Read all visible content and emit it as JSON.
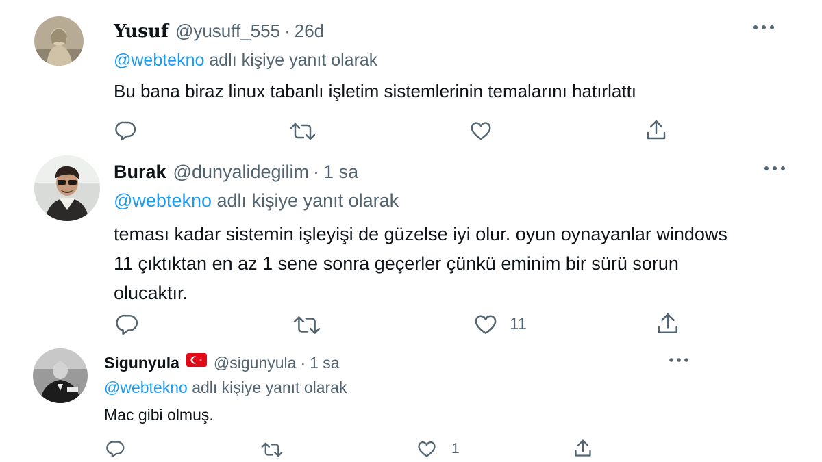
{
  "tweets": [
    {
      "name": "Yusuf",
      "handle": "@yusuff_555",
      "separator": "·",
      "time": "26d",
      "reply_mention": "@webtekno",
      "reply_suffix": "adlı kişiye yanıt olarak",
      "text": "Bu bana biraz linux tabanlı işletim sistemlerinin temalarını hatırlattı",
      "likes": ""
    },
    {
      "name": "Burak",
      "handle": "@dunyalidegilim",
      "separator": "·",
      "time": "1 sa",
      "reply_mention": "@webtekno",
      "reply_suffix": "adlı kişiye yanıt olarak",
      "text_lines": [
        "teması kadar sistemin işleyişi de güzelse iyi olur. oyun oynayanlar windows",
        "11 çıktıktan en az 1 sene sonra geçerler çünkü eminim bir sürü sorun",
        "olucaktır."
      ],
      "likes": "11"
    },
    {
      "name": "Sigunyula",
      "handle": "@sigunyula",
      "separator": "·",
      "time": "1 sa",
      "reply_mention": "@webtekno",
      "reply_suffix": "adlı kişiye yanıt olarak",
      "text": "Mac gibi olmuş.",
      "likes": "1"
    }
  ],
  "icons": {
    "reply": "reply-icon",
    "retweet": "retweet-icon",
    "like": "heart-icon",
    "share": "share-icon",
    "more": "more-icon",
    "flag": "turkey-flag-icon"
  },
  "colors": {
    "link": "#1d9bf0",
    "secondary": "#536471",
    "text": "#0f1419",
    "flag_red": "#e30a17"
  }
}
